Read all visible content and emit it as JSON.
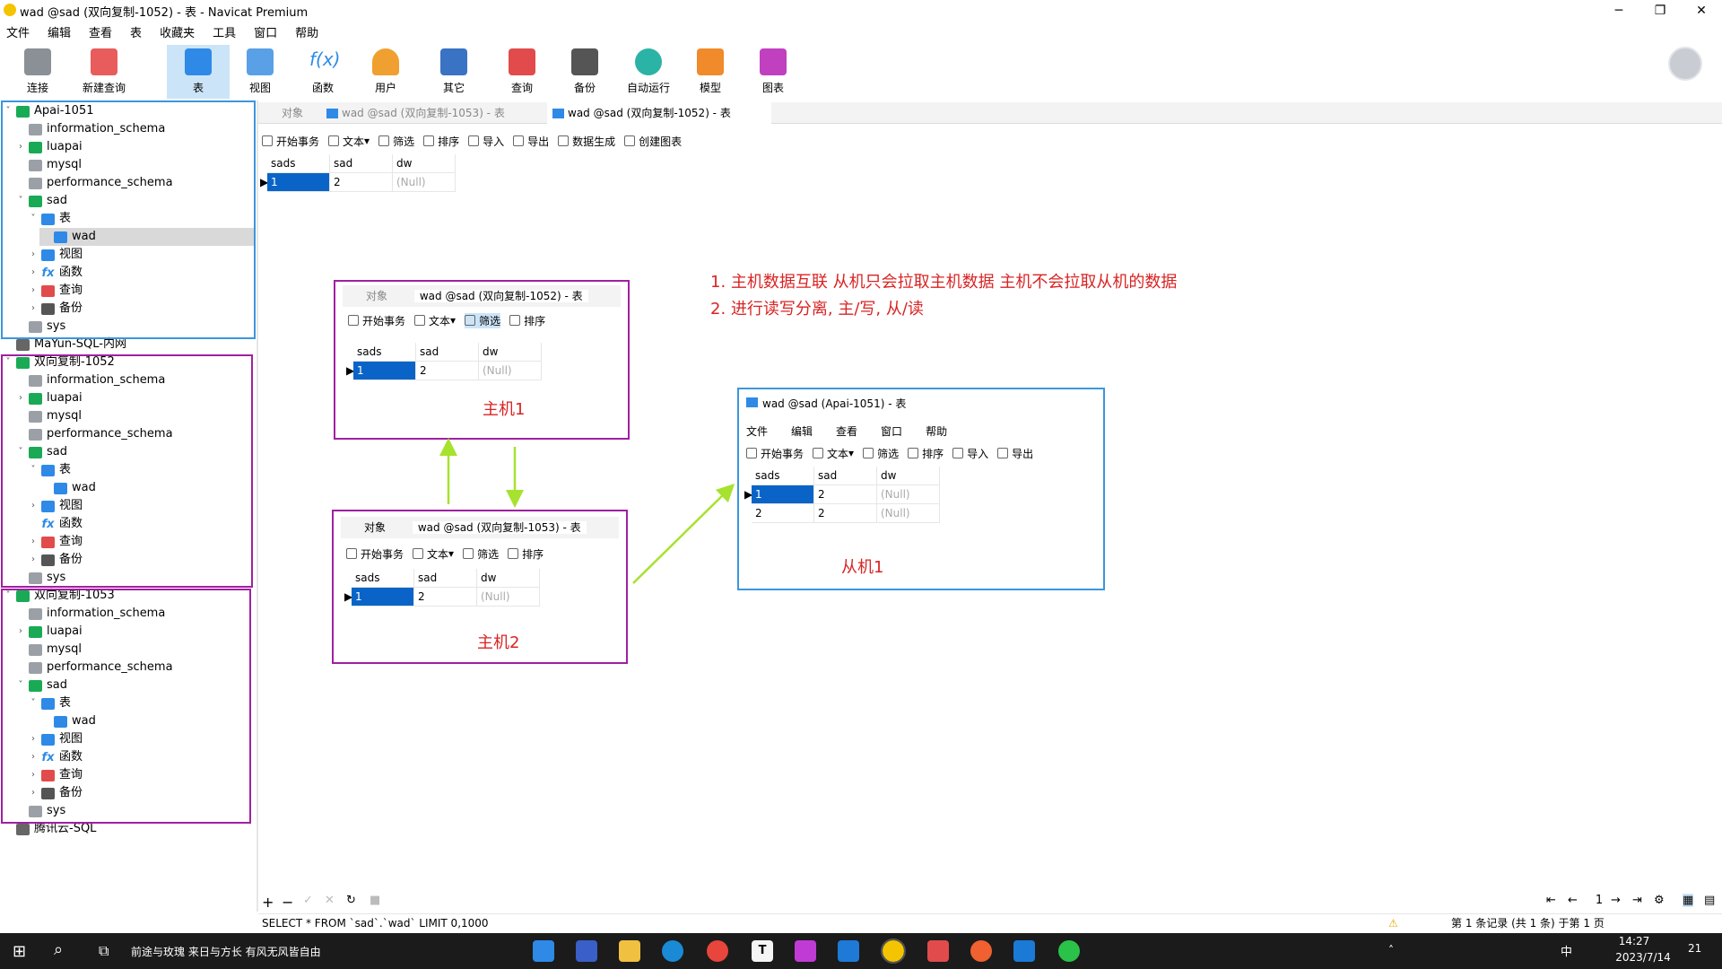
{
  "window": {
    "title": "wad @sad (双向复制-1052) - 表 - Navicat Premium"
  },
  "menu": [
    "文件",
    "编辑",
    "查看",
    "表",
    "收藏夹",
    "工具",
    "窗口",
    "帮助"
  ],
  "toolbar": [
    "连接",
    "新建查询",
    "表",
    "视图",
    "函数",
    "用户",
    "其它",
    "查询",
    "备份",
    "自动运行",
    "模型",
    "图表"
  ],
  "tree": {
    "c1": "Apai-1051",
    "c2": "MaYun-SQL-内网",
    "c3": "双向复制-1052",
    "c4": "双向复制-1053",
    "c5": "腾讯云-SQL",
    "dbs": [
      "information_schema",
      "luapai",
      "mysql",
      "performance_schema",
      "sad",
      "sys"
    ],
    "nodes": [
      "表",
      "wad",
      "视图",
      "函数",
      "查询",
      "备份"
    ]
  },
  "tabs": {
    "objects": "对象",
    "t1": "wad @sad (双向复制-1053) - 表",
    "t2": "wad @sad (双向复制-1052) - 表"
  },
  "subtoolbar": [
    "开始事务",
    "文本",
    "筛选",
    "排序",
    "导入",
    "导出",
    "数据生成",
    "创建图表"
  ],
  "grid": {
    "cols": [
      "sads",
      "sad",
      "dw"
    ],
    "r1": [
      "1",
      "2",
      "(Null)"
    ],
    "r2": [
      "2",
      "2",
      "(Null)"
    ]
  },
  "panels": {
    "m1_title": "wad @sad (双向复制-1052) - 表",
    "m1_caption": "主机1",
    "m2_title": "wad @sad (双向复制-1053) - 表",
    "m2_caption": "主机2",
    "s1_title": "wad @sad (Apai-1051) - 表",
    "s1_caption": "从机1",
    "s1_menu": [
      "文件",
      "编辑",
      "查看",
      "窗口",
      "帮助"
    ]
  },
  "annotations": {
    "n1": "1. 主机数据互联 从机只会拉取主机数据 主机不会拉取从机的数据",
    "n2": "2. 进行读写分离, 主/写, 从/读"
  },
  "status": {
    "sql": "SELECT * FROM `sad`.`wad` LIMIT 0,1000",
    "records": "第 1 条记录 (共 1 条) 于第 1 页",
    "page": "1"
  },
  "taskbar": {
    "search_text": "前途与玫瑰 来日与方长 有风无风皆自由",
    "time": "14:27",
    "date": "2023/7/14",
    "ime": "中",
    "notif": "21"
  },
  "colors": {
    "accent": "#0a64c8",
    "annotation": "#d92323",
    "box_master": "#a020a0",
    "box_slave": "#3c96dc",
    "arrow": "#a6e22e"
  }
}
